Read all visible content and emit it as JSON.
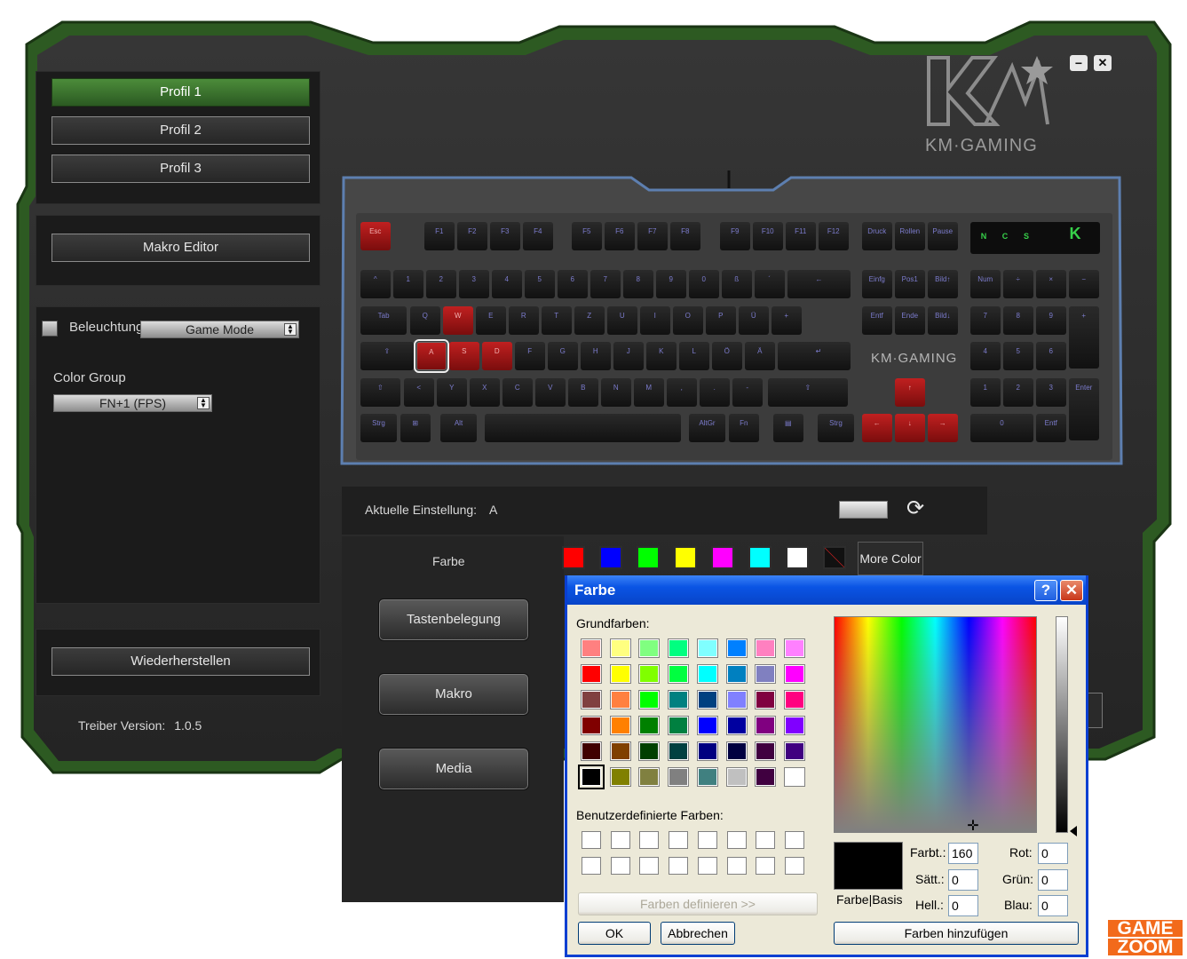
{
  "window": {
    "minimize_label": "−",
    "close_label": "✕"
  },
  "brand": {
    "name": "KM·GAMING"
  },
  "profiles": [
    {
      "label": "Profil 1"
    },
    {
      "label": "Profil 2"
    },
    {
      "label": "Profil 3"
    }
  ],
  "active_profile": 0,
  "macro_editor_label": "Makro Editor",
  "lighting": {
    "label": "Beleuchtung",
    "mode": "Game Mode"
  },
  "color_group": {
    "label": "Color Group",
    "value": "FN+1 (FPS)"
  },
  "restore_label": "Wiederherstellen",
  "driver": {
    "label": "Treiber Version:",
    "version": "1.0.5"
  },
  "keyboard": {
    "indicators": [
      "N",
      "C",
      "S"
    ],
    "brand_text": "KM·GAMING",
    "rows": [
      [
        "Esc",
        "F1",
        "F2",
        "F3",
        "F4",
        "F5",
        "F6",
        "F7",
        "F8",
        "F9",
        "F10",
        "F11",
        "F12",
        "Druck",
        "Rollen",
        "Pause"
      ],
      [
        "^",
        "1",
        "2",
        "3",
        "4",
        "5",
        "6",
        "7",
        "8",
        "9",
        "0",
        "ß",
        "´",
        "←",
        "Einfg",
        "Pos1",
        "Bild↑",
        "Num",
        "÷",
        "×",
        "−"
      ],
      [
        "Tab",
        "Q",
        "W",
        "E",
        "R",
        "T",
        "Z",
        "U",
        "I",
        "O",
        "P",
        "Ü",
        "+",
        "Entf",
        "Ende",
        "Bild↓",
        "7",
        "8",
        "9",
        "+"
      ],
      [
        "⇪",
        "A",
        "S",
        "D",
        "F",
        "G",
        "H",
        "J",
        "K",
        "L",
        "Ö",
        "Ä",
        "#",
        "↵",
        "4",
        "5",
        "6"
      ],
      [
        "⇧",
        "<",
        "Y",
        "X",
        "C",
        "V",
        "B",
        "N",
        "M",
        ",",
        ".",
        "-",
        "⇧",
        "↑",
        "1",
        "2",
        "3",
        "Enter"
      ],
      [
        "Strg",
        "⊞",
        "Alt",
        "",
        "AltGr",
        "Fn",
        "▤",
        "Strg",
        "←",
        "↓",
        "→",
        "0",
        "Entf"
      ]
    ]
  },
  "current_setting": {
    "label": "Aktuelle Einstellung:",
    "value": "A"
  },
  "color_bar": {
    "label": "Farbe",
    "swatches": [
      "#ff0000",
      "#0000ff",
      "#00ff00",
      "#ffff00",
      "#ff00ff",
      "#00ffff",
      "#ffffff",
      "none"
    ],
    "more_label": "More Color"
  },
  "side_buttons": [
    {
      "label": "Tastenbelegung"
    },
    {
      "label": "Makro"
    },
    {
      "label": "Media"
    }
  ],
  "dialog": {
    "title": "Farbe",
    "help_label": "?",
    "close_label": "✕",
    "basic_label": "Grundfarben:",
    "basic_colors": [
      "#ff8080",
      "#ffff80",
      "#80ff80",
      "#00ff80",
      "#80ffff",
      "#0080ff",
      "#ff80c0",
      "#ff80ff",
      "#ff0000",
      "#ffff00",
      "#80ff00",
      "#00ff40",
      "#00ffff",
      "#0080c0",
      "#8080c0",
      "#ff00ff",
      "#804040",
      "#ff8040",
      "#00ff00",
      "#008080",
      "#004080",
      "#8080ff",
      "#800040",
      "#ff0080",
      "#800000",
      "#ff8000",
      "#008000",
      "#008040",
      "#0000ff",
      "#0000a0",
      "#800080",
      "#8000ff",
      "#400000",
      "#804000",
      "#004000",
      "#004040",
      "#000080",
      "#000040",
      "#400040",
      "#400080",
      "#000000",
      "#808000",
      "#808040",
      "#808080",
      "#408080",
      "#c0c0c0",
      "#400040",
      "#ffffff"
    ],
    "selected_index": 40,
    "custom_label": "Benutzerdefinierte Farben:",
    "define_label": "Farben definieren >>",
    "ok_label": "OK",
    "cancel_label": "Abbrechen",
    "preview_label": "Farbe|Basis",
    "add_label": "Farben hinzufügen",
    "fields": {
      "hue": {
        "label": "Farbt.:",
        "value": "160"
      },
      "sat": {
        "label": "Sätt.:",
        "value": "0"
      },
      "lum": {
        "label": "Hell.:",
        "value": "0"
      },
      "red": {
        "label": "Rot:",
        "value": "0"
      },
      "green": {
        "label": "Grün:",
        "value": "0"
      },
      "blue": {
        "label": "Blau:",
        "value": "0"
      }
    }
  },
  "watermark": {
    "line1": "GAME",
    "line2": "ZOOM"
  },
  "colors": {
    "accent_green": "#3f7d2e",
    "key_red": "#c02020",
    "xp_blue": "#0a54e4"
  }
}
